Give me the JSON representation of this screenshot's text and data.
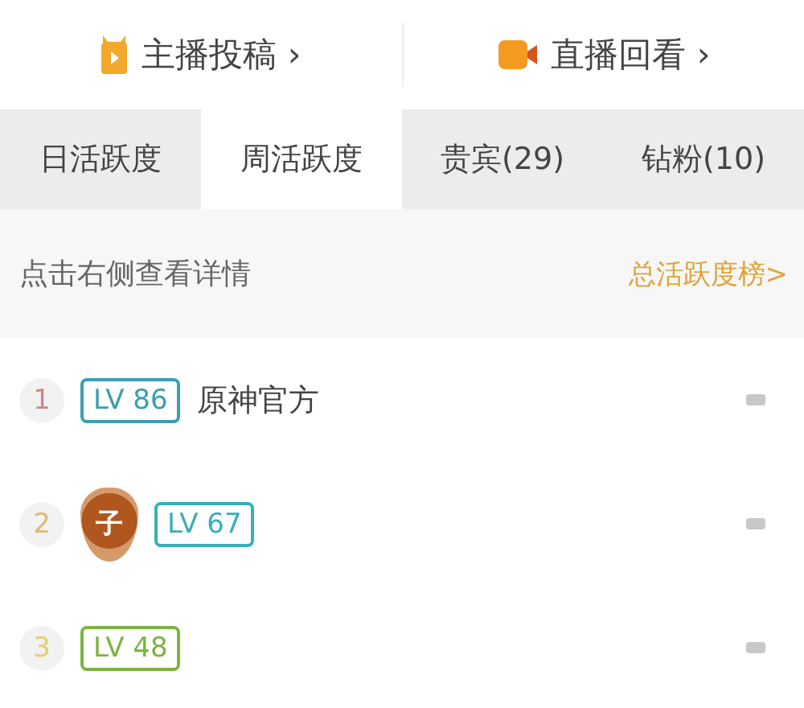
{
  "top_links": [
    {
      "kind": "video",
      "label": "主播投稿",
      "chevron": "›"
    },
    {
      "kind": "camera",
      "label": "直播回看",
      "chevron": "›"
    }
  ],
  "tabs": [
    {
      "label": "日活跃度",
      "selected": false
    },
    {
      "label": "周活跃度",
      "selected": true
    },
    {
      "label": "贵宾(29)",
      "selected": false
    },
    {
      "label": "钻粉(10)",
      "selected": false
    }
  ],
  "hint": {
    "text": "点击右侧查看详情",
    "link": "总活跃度榜>"
  },
  "rows": [
    {
      "rank": {
        "text": "1",
        "color": "#c98a8a"
      },
      "level": {
        "text": "LV 86",
        "color": "#3a9fae"
      },
      "name": "原神官方"
    },
    {
      "rank": {
        "text": "2",
        "color": "#e0b870"
      },
      "badge": "子",
      "level": {
        "text": "LV 67",
        "color": "#3aaeb8"
      }
    },
    {
      "rank": {
        "text": "3",
        "color": "#e6cf6a"
      },
      "level": {
        "text": "LV 48",
        "color": "#7cb342"
      }
    }
  ]
}
